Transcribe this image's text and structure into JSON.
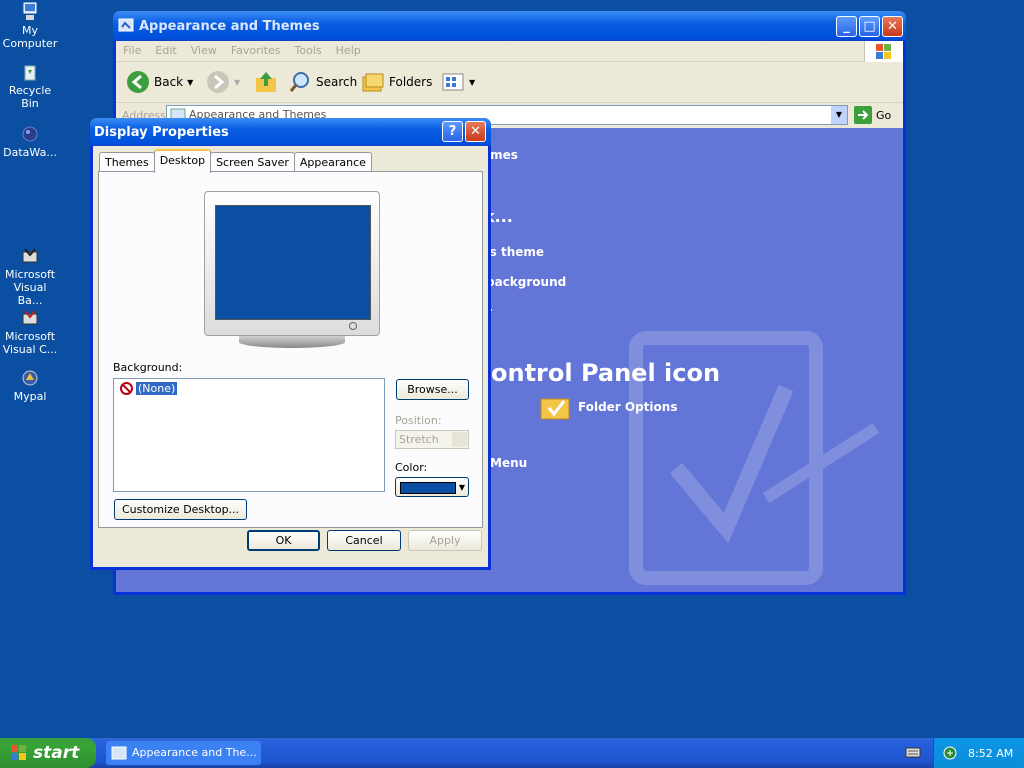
{
  "desktop": {
    "icons": [
      {
        "label": "My Computer"
      },
      {
        "label": "Recycle Bin"
      },
      {
        "label": "DataWa..."
      },
      {
        "label": "Microsoft Visual Ba..."
      },
      {
        "label": "Microsoft Visual C..."
      },
      {
        "label": "Mypal"
      }
    ]
  },
  "explorer": {
    "title": "Appearance and Themes",
    "menu": [
      "File",
      "Edit",
      "View",
      "Favorites",
      "Tools",
      "Help"
    ],
    "toolbar": {
      "back": "Back",
      "search": "Search",
      "folders": "Folders"
    },
    "address_label": "Address",
    "address_value": "Appearance and Themes",
    "go_label": "Go",
    "panel_texts": [
      "emes",
      "k...",
      "'s theme",
      "background",
      "r",
      "ontrol Panel icon",
      "Menu"
    ],
    "folder_options": "Folder Options"
  },
  "dialog": {
    "title": "Display Properties",
    "tabs": [
      "Themes",
      "Desktop",
      "Screen Saver",
      "Appearance"
    ],
    "active_tab": "Desktop",
    "background_label": "Background:",
    "background_item": "(None)",
    "browse": "Browse...",
    "position_label": "Position:",
    "position_value": "Stretch",
    "color_label": "Color:",
    "color_value": "#0a4fa1",
    "customize": "Customize Desktop...",
    "ok": "OK",
    "cancel": "Cancel",
    "apply": "Apply"
  },
  "taskbar": {
    "start": "start",
    "task_label": "Appearance and The...",
    "clock": "8:52 AM"
  }
}
